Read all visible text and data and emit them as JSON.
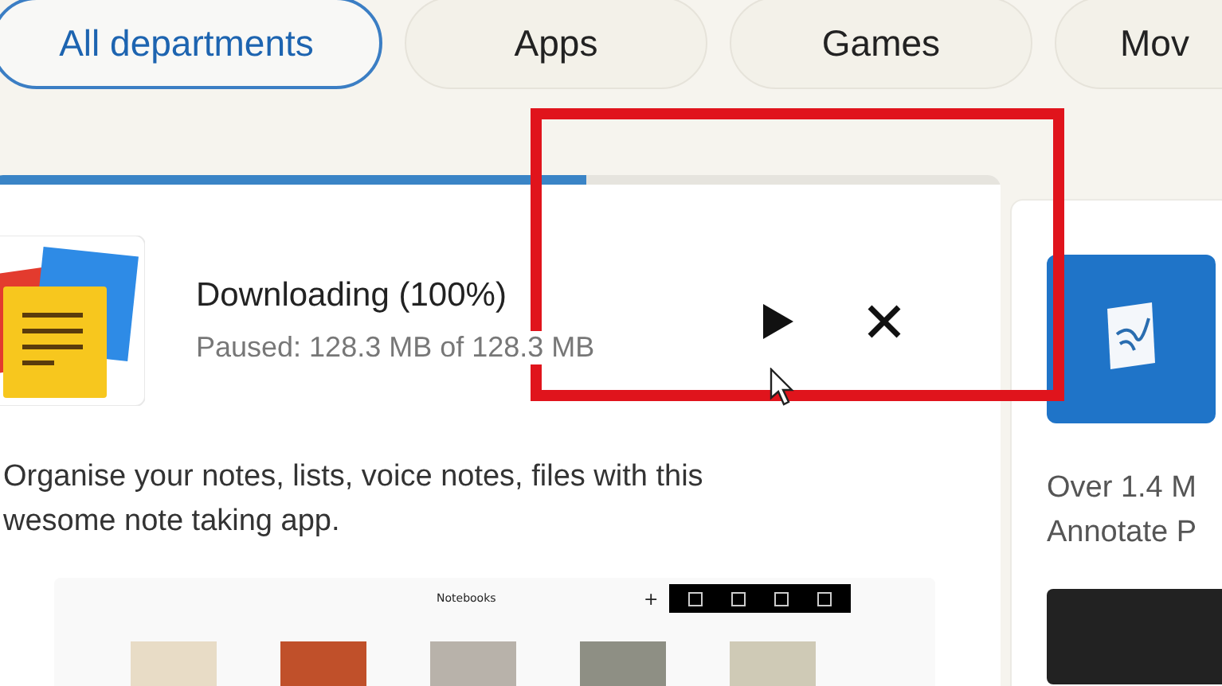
{
  "categories": [
    {
      "label": "All departments",
      "selected": true
    },
    {
      "label": "Apps",
      "selected": false
    },
    {
      "label": "Games",
      "selected": false
    },
    {
      "label": "Mov",
      "selected": false
    }
  ],
  "download_card": {
    "status": "Downloading (100%)",
    "detail": "Paused: 128.3 MB of 128.3 MB",
    "level": 0.59,
    "description": [
      "Organise your notes, lists, voice notes, files with this",
      "wesome note taking app."
    ],
    "screenshot": {
      "title": "Notebooks",
      "add": "+"
    }
  },
  "side_card": {
    "description": [
      "Over 1.4 M",
      "Annotate P"
    ]
  }
}
